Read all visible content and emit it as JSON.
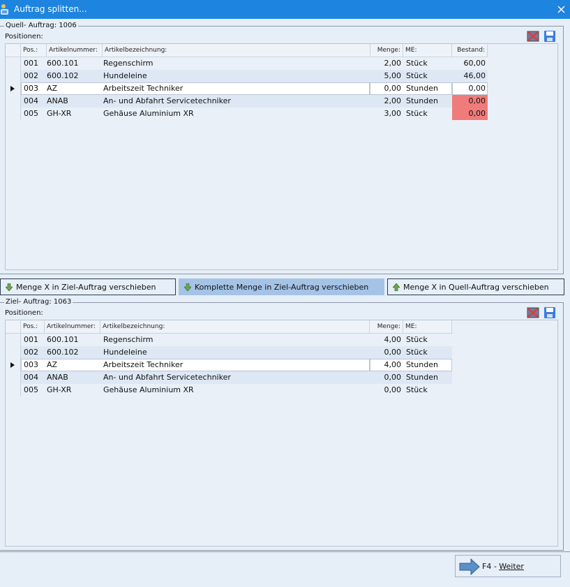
{
  "window": {
    "title": "Auftrag splitten...",
    "close_glyph": "✕"
  },
  "source": {
    "legend": "Quell- Auftrag: 1006",
    "caption": "Positionen:",
    "headers": {
      "pos": "Pos.:",
      "artnr": "Artikelnummer:",
      "bez": "Artikelbezeichnung:",
      "menge": "Menge:",
      "me": "ME:",
      "bestand": "Bestand:"
    },
    "rows": [
      {
        "pos": "001",
        "artnr": "600.101",
        "bez": "Regenschirm",
        "menge": "2,00",
        "me": "Stück",
        "bestand": "60,00"
      },
      {
        "pos": "002",
        "artnr": "600.102",
        "bez": "Hundeleine",
        "menge": "5,00",
        "me": "Stück",
        "bestand": "46,00"
      },
      {
        "pos": "003",
        "artnr": "AZ",
        "bez": "Arbeitszeit Techniker",
        "menge": "0,00",
        "me": "Stunden",
        "bestand": "0,00"
      },
      {
        "pos": "004",
        "artnr": "ANAB",
        "bez": "An- und Abfahrt Servicetechniker",
        "menge": "2,00",
        "me": "Stunden",
        "bestand": "0,00"
      },
      {
        "pos": "005",
        "artnr": "GH-XR",
        "bez": "Gehäuse Aluminium XR",
        "menge": "3,00",
        "me": "Stück",
        "bestand": "0,00"
      }
    ]
  },
  "actions": {
    "move_x_down": "Menge X in Ziel-Auftrag verschieben",
    "move_all_down": "Komplette Menge in Ziel-Auftrag verschieben",
    "move_x_up": "Menge X in Quell-Auftrag verschieben"
  },
  "target": {
    "legend": "Ziel- Auftrag: 1063",
    "caption": "Positionen:",
    "headers": {
      "pos": "Pos.:",
      "artnr": "Artikelnummer:",
      "bez": "Artikelbezeichnung:",
      "menge": "Menge:",
      "me": "ME:"
    },
    "rows": [
      {
        "pos": "001",
        "artnr": "600.101",
        "bez": "Regenschirm",
        "menge": "4,00",
        "me": "Stück"
      },
      {
        "pos": "002",
        "artnr": "600.102",
        "bez": "Hundeleine",
        "menge": "0,00",
        "me": "Stück"
      },
      {
        "pos": "003",
        "artnr": "AZ",
        "bez": "Arbeitszeit Techniker",
        "menge": "4,00",
        "me": "Stunden"
      },
      {
        "pos": "004",
        "artnr": "ANAB",
        "bez": "An- und Abfahrt Servicetechniker",
        "menge": "0,00",
        "me": "Stunden"
      },
      {
        "pos": "005",
        "artnr": "GH-XR",
        "bez": "Gehäuse Aluminium XR",
        "menge": "0,00",
        "me": "Stück"
      }
    ]
  },
  "footer": {
    "next_key": "F4 - ",
    "next_label": "Weiter"
  },
  "colors": {
    "titlebar": "#1d84df",
    "background": "#e6eef7",
    "stock_warning": "#f07b7b",
    "active_button": "#a4c3e6"
  },
  "icons": {
    "app": "app-icon",
    "close": "close-icon",
    "clear": "clear-icon",
    "save": "save-icon",
    "arrow_down": "arrow-down-icon",
    "arrow_up": "arrow-up-icon",
    "next": "arrow-right-icon"
  }
}
